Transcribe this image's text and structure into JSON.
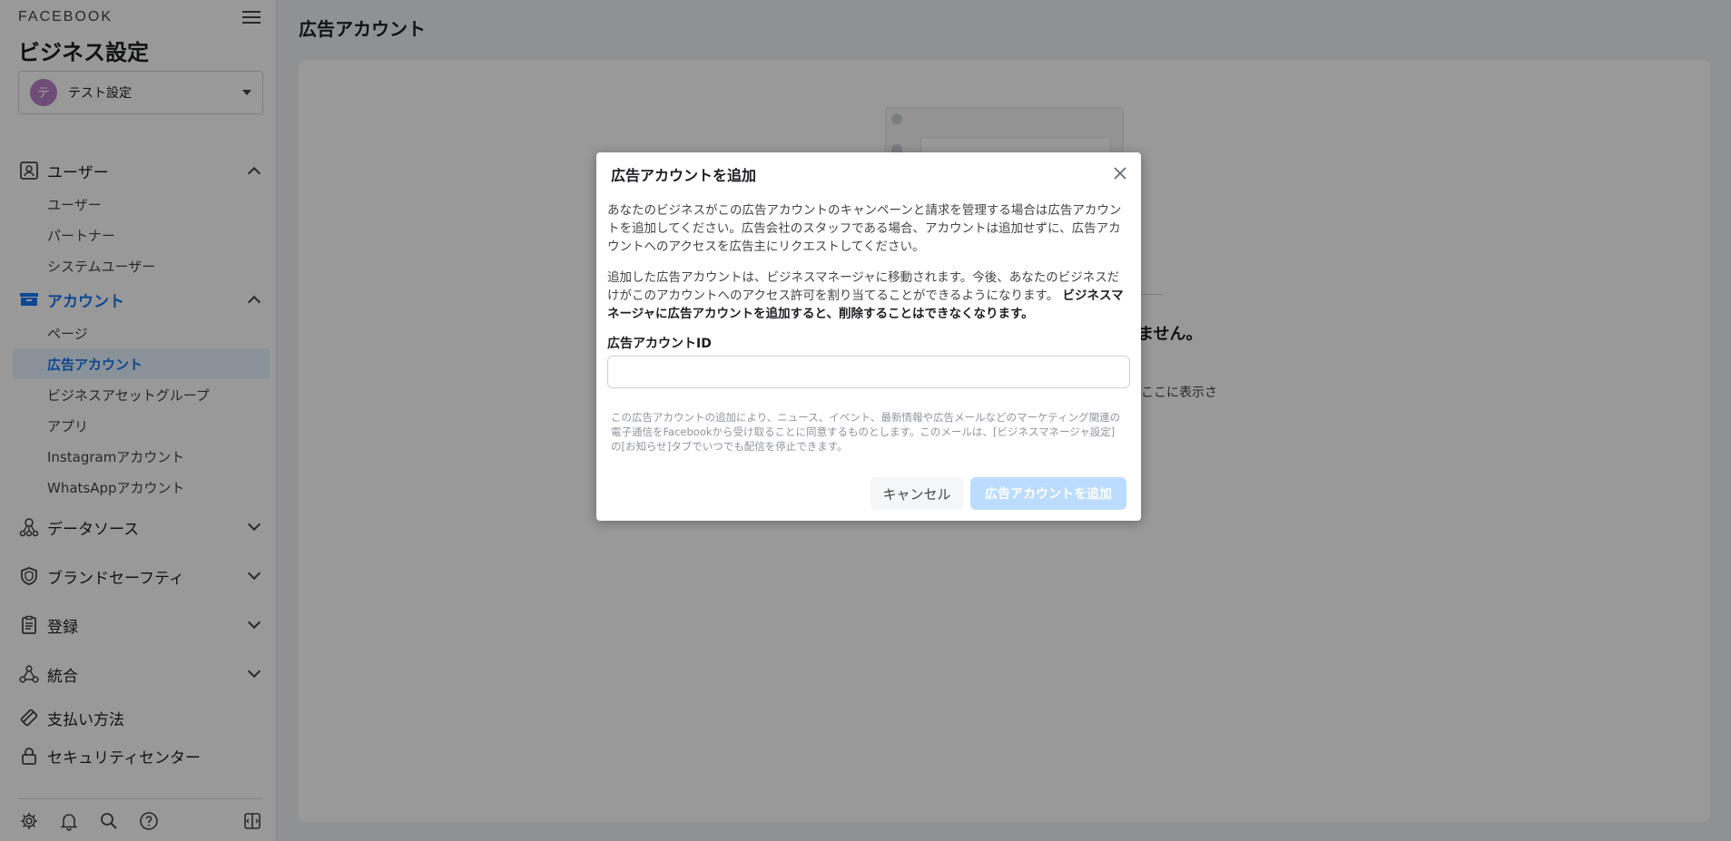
{
  "sidebar": {
    "brand": "FACEBOOK",
    "app_title": "ビジネス設定",
    "business": {
      "avatar_letter": "テ",
      "name": "テスト設定",
      "avatar_color": "#b980c8"
    },
    "groups": [
      {
        "label": "ユーザー",
        "icon": "user-badge-icon",
        "expanded": true,
        "items": [
          "ユーザー",
          "パートナー",
          "システムユーザー"
        ]
      },
      {
        "label": "アカウント",
        "icon": "account-folder-icon",
        "expanded": true,
        "active": true,
        "items": [
          "ページ",
          "広告アカウント",
          "ビジネスアセットグループ",
          "アプリ",
          "Instagramアカウント",
          "WhatsAppアカウント"
        ]
      },
      {
        "label": "データソース",
        "icon": "data-source-icon",
        "expanded": false
      },
      {
        "label": "ブランドセーフティ",
        "icon": "shield-icon",
        "expanded": false
      },
      {
        "label": "登録",
        "icon": "clipboard-icon",
        "expanded": false
      },
      {
        "label": "統合",
        "icon": "integrations-icon",
        "expanded": false
      },
      {
        "label": "支払い方法",
        "icon": "payment-icon"
      },
      {
        "label": "セキュリティセンター",
        "icon": "lock-icon"
      }
    ],
    "selected_item": "広告アカウント",
    "bottom_icons": [
      "settings-icon",
      "bell-icon",
      "search-icon",
      "help-icon",
      "panel-toggle-icon"
    ]
  },
  "main": {
    "title": "広告アカウント",
    "background_heading_fragment": "ません。",
    "background_sub_fragment": "がここに表示さ"
  },
  "modal": {
    "title": "広告アカウントを追加",
    "paragraph1": "あなたのビジネスがこの広告アカウントのキャンペーンと請求を管理する場合は広告アカウントを追加してください。広告会社のスタッフである場合、アカウントは追加せずに、広告アカウントへのアクセスを広告主にリクエストしてください。",
    "paragraph2_normal": "追加した広告アカウントは、ビジネスマネージャに移動されます。今後、あなたのビジネスだけがこのアカウントへのアクセス許可を割り当てることができるようになります。",
    "paragraph2_bold": "ビジネスマネージャに広告アカウントを追加すると、削除することはできなくなります。",
    "field_label": "広告アカウントID",
    "field_value": "",
    "consent": "この広告アカウントの追加により、ニュース、イベント、最新情報や広告メールなどのマーケティング関連の電子通信をFacebookから受け取ることに同意するものとします。このメールは、[ビジネスマネージャ設定]の[お知らせ]タブでいつでも配信を停止できます。",
    "cancel_label": "キャンセル",
    "add_label": "広告アカウントを追加"
  },
  "colors": {
    "accent": "#1877f2",
    "selected_bg": "#e7f3ff",
    "disabled_button": "#bcdcff"
  }
}
